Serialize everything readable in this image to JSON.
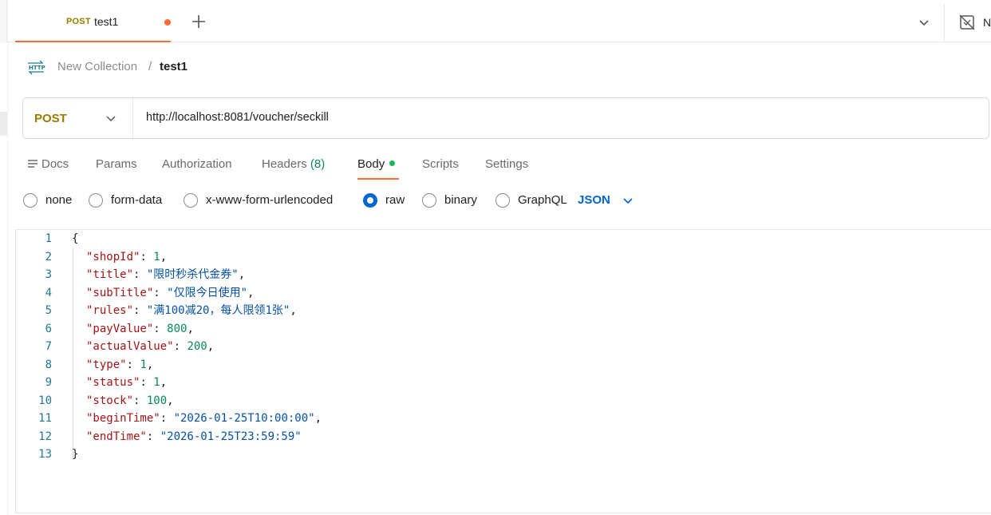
{
  "tabs": [
    {
      "method": "POST",
      "name": "test1",
      "unsaved": true
    }
  ],
  "env_label": "N",
  "breadcrumb": {
    "collection": "New Collection",
    "separator": "/",
    "request": "test1"
  },
  "request": {
    "method": "POST",
    "url": "http://localhost:8081/voucher/seckill"
  },
  "subtabs": {
    "docs": "Docs",
    "params": "Params",
    "authorization": "Authorization",
    "headers": "Headers",
    "headers_count": "(8)",
    "body": "Body",
    "scripts": "Scripts",
    "settings": "Settings"
  },
  "body_types": {
    "none": "none",
    "form_data": "form-data",
    "urlencoded": "x-www-form-urlencoded",
    "raw": "raw",
    "binary": "binary",
    "graphql": "GraphQL",
    "selected": "raw",
    "language": "JSON"
  },
  "editor": {
    "lines": [
      {
        "n": "1",
        "key": "",
        "value": "",
        "text": "{"
      },
      {
        "n": "2",
        "key": "\"shopId\"",
        "value": "1",
        "vtype": "n",
        "comma": true
      },
      {
        "n": "3",
        "key": "\"title\"",
        "value": "\"限时秒杀代金券\"",
        "vtype": "s",
        "comma": true
      },
      {
        "n": "4",
        "key": "\"subTitle\"",
        "value": "\"仅限今日使用\"",
        "vtype": "s",
        "comma": true
      },
      {
        "n": "5",
        "key": "\"rules\"",
        "value": "\"满100减20，每人限领1张\"",
        "vtype": "s",
        "comma": true
      },
      {
        "n": "6",
        "key": "\"payValue\"",
        "value": "800",
        "vtype": "n",
        "comma": true
      },
      {
        "n": "7",
        "key": "\"actualValue\"",
        "value": "200",
        "vtype": "n",
        "comma": true
      },
      {
        "n": "8",
        "key": "\"type\"",
        "value": "1",
        "vtype": "n",
        "comma": true
      },
      {
        "n": "9",
        "key": "\"status\"",
        "value": "1",
        "vtype": "n",
        "comma": true
      },
      {
        "n": "10",
        "key": "\"stock\"",
        "value": "100",
        "vtype": "n",
        "comma": true
      },
      {
        "n": "11",
        "key": "\"beginTime\"",
        "value": "\"2026-01-25T10:00:00\"",
        "vtype": "s",
        "comma": true
      },
      {
        "n": "12",
        "key": "\"endTime\"",
        "value": "\"2026-01-25T23:59:59\"",
        "vtype": "s",
        "comma": false
      },
      {
        "n": "13",
        "key": "",
        "value": "",
        "text": "}"
      }
    ]
  },
  "colors": {
    "accent": "#ff6c37",
    "post_method": "#9a7a00",
    "link_blue": "#0265d2",
    "json_key": "#a31515",
    "json_string": "#0451a5",
    "json_number": "#098658",
    "line_number": "#237893"
  }
}
